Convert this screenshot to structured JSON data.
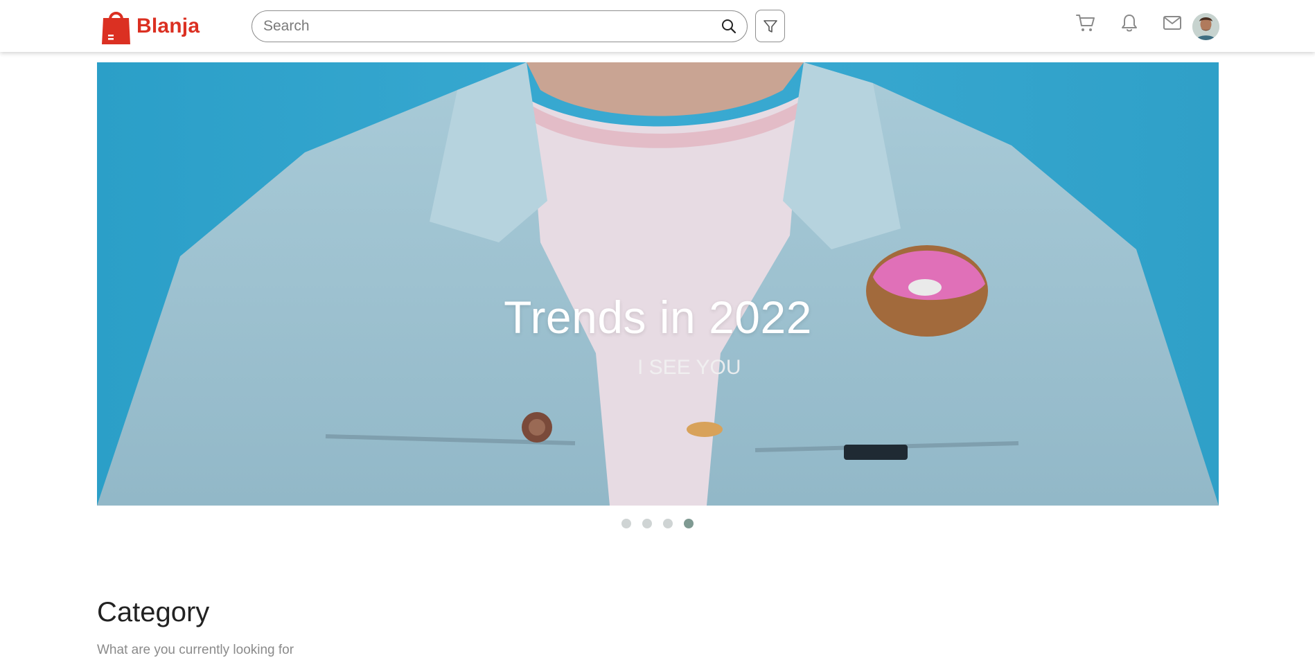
{
  "brand": {
    "name": "Blanja",
    "color": "#DB3022",
    "logo_icon": "shopping-bag-icon"
  },
  "search": {
    "placeholder": "Search",
    "value": "",
    "icon": "search-icon"
  },
  "filter": {
    "icon": "filter-funnel-icon"
  },
  "nav": {
    "cart_icon": "cart-icon",
    "notification_icon": "bell-icon",
    "mail_icon": "mail-icon",
    "avatar_icon": "user-avatar"
  },
  "hero": {
    "title": "Trends in 2022",
    "slides_total": 4,
    "active_slide": 4,
    "background_color": "#2fa2c9"
  },
  "category": {
    "title": "Category",
    "subtitle": "What are you currently looking for"
  }
}
